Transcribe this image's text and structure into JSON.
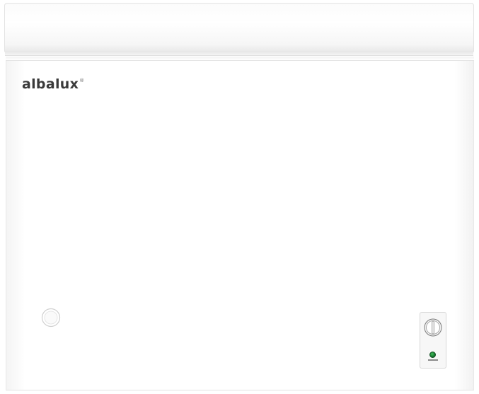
{
  "image": {
    "subject": "chest freezer",
    "background_color": "#ffffff",
    "body_color": "#ffffff"
  },
  "freezer": {
    "brand_label": "albalux",
    "brand_mark": "®",
    "controls": {
      "thermostat": "thermostat-knob-icon",
      "indicator": "power-indicator-light",
      "indicator_color": "#2a9a45"
    },
    "drain": "drain-cap-icon"
  }
}
